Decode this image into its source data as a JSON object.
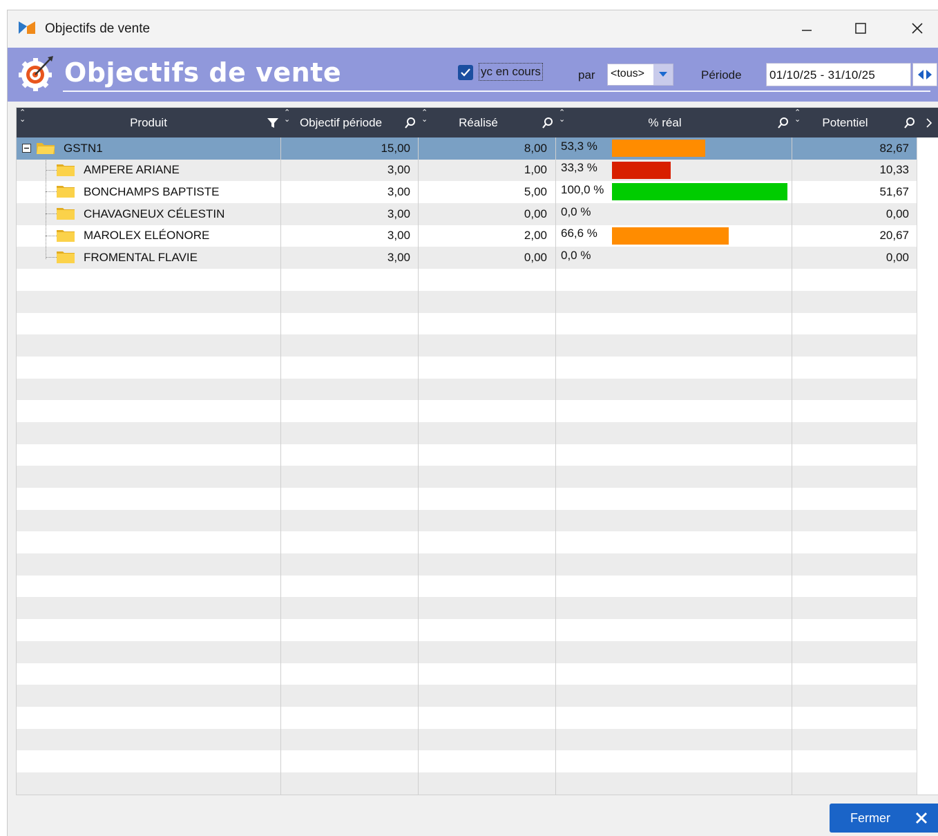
{
  "window": {
    "title": "Objectifs de vente"
  },
  "banner": {
    "title": "Objectifs de vente",
    "include_current_label": "yc en cours",
    "include_current_checked": true,
    "par_label": "par",
    "par_value": "<tous>",
    "periode_label": "Période",
    "periode_value": "01/10/25 - 31/10/25"
  },
  "grid": {
    "columns": [
      "Produit",
      "Objectif période",
      "Réalisé",
      "% réal",
      "Potentiel"
    ],
    "rows": [
      {
        "name": "GSTN1",
        "objectif": "15,00",
        "realise": "8,00",
        "pct_text": "53,3 %",
        "pct": 53.3,
        "bar_color": "#ff8c00",
        "potentiel": "82,67"
      },
      {
        "name": "AMPERE ARIANE",
        "objectif": "3,00",
        "realise": "1,00",
        "pct_text": "33,3 %",
        "pct": 33.3,
        "bar_color": "#d81f00",
        "potentiel": "10,33"
      },
      {
        "name": "BONCHAMPS BAPTISTE",
        "objectif": "3,00",
        "realise": "5,00",
        "pct_text": "100,0 %",
        "pct": 100.0,
        "bar_color": "#00cc00",
        "potentiel": "51,67"
      },
      {
        "name": "CHAVAGNEUX CÉLESTIN",
        "objectif": "3,00",
        "realise": "0,00",
        "pct_text": "0,0 %",
        "pct": 0.0,
        "bar_color": "#d81f00",
        "potentiel": "0,00"
      },
      {
        "name": "MAROLEX ELÉONORE",
        "objectif": "3,00",
        "realise": "2,00",
        "pct_text": "66,6 %",
        "pct": 66.6,
        "bar_color": "#ff8c00",
        "potentiel": "20,67"
      },
      {
        "name": "FROMENTAL FLAVIE",
        "objectif": "3,00",
        "realise": "0,00",
        "pct_text": "0,0 %",
        "pct": 0.0,
        "bar_color": "#d81f00",
        "potentiel": "0,00"
      }
    ]
  },
  "footer": {
    "close_label": "Fermer"
  }
}
